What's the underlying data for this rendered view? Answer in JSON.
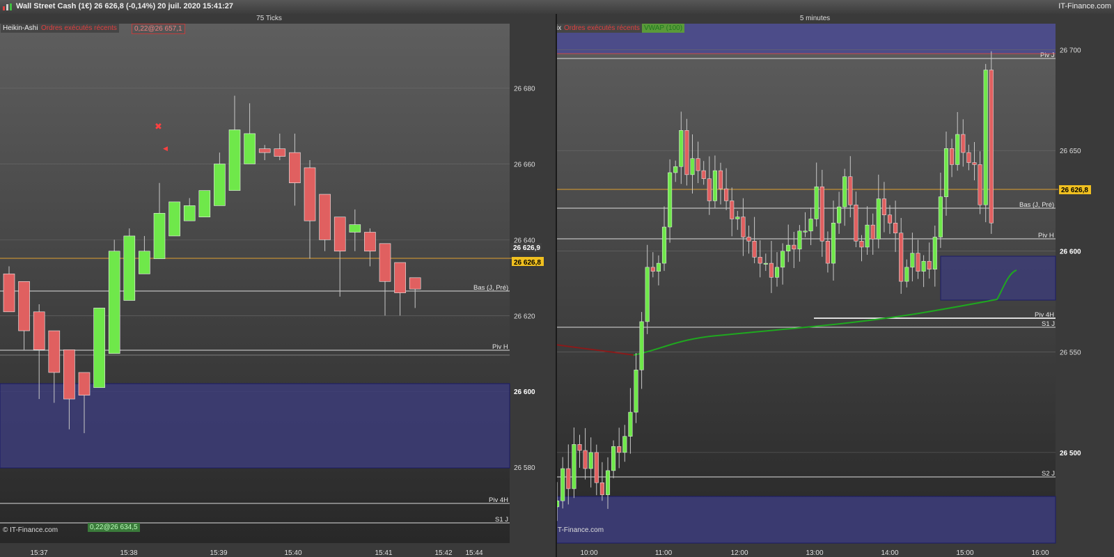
{
  "window": {
    "title": "Wall Street Cash (1€)   26 626,8 (-0,14%)   20 juil. 2020 15:41:27",
    "brand": "IT-Finance.com"
  },
  "colors": {
    "up": "#6fe84a",
    "down": "#e06060",
    "price_line": "#e0a030",
    "zone": "#3c3c78",
    "vwap": "#1fa81f",
    "ma": "#8a1a1a"
  },
  "left_chart": {
    "header": "75 Ticks",
    "tags": [
      "Heikin-Ashi",
      "Ordres exécutés récents",
      "0,22@26 657,1"
    ],
    "bottom_tag": "0,22@26 634,5",
    "watermark": "© IT-Finance.com",
    "y_ticks": [
      "26 680",
      "26 660",
      "26 640",
      "26 620",
      "26 600",
      "26 580"
    ],
    "price_labels": [
      "26 626,9",
      "26 626,8"
    ],
    "x_ticks": [
      "15:37",
      "15:38",
      "15:39",
      "15:40",
      "15:41",
      "15:42",
      "15:44"
    ],
    "levels": [
      "Bas (J, Pré)",
      "Piv H",
      "Piv 4H",
      "S1 J"
    ],
    "chart_data": {
      "type": "candlestick",
      "style": "heikin-ashi",
      "ylim": [
        26560,
        26697
      ],
      "candles": [
        {
          "o": 26631,
          "h": 26633,
          "l": 26621,
          "c": 26621,
          "dir": "down"
        },
        {
          "o": 26629,
          "h": 26629,
          "l": 26611,
          "c": 26616,
          "dir": "down"
        },
        {
          "o": 26621,
          "h": 26623,
          "l": 26598,
          "c": 26611,
          "dir": "down"
        },
        {
          "o": 26616,
          "h": 26616,
          "l": 26597,
          "c": 26605,
          "dir": "down"
        },
        {
          "o": 26611,
          "h": 26611,
          "l": 26590,
          "c": 26598,
          "dir": "down"
        },
        {
          "o": 26605,
          "h": 26605,
          "l": 26589,
          "c": 26599,
          "dir": "down"
        },
        {
          "o": 26601,
          "h": 26622,
          "l": 26601,
          "c": 26622,
          "dir": "up"
        },
        {
          "o": 26610,
          "h": 26640,
          "l": 26610,
          "c": 26637,
          "dir": "up"
        },
        {
          "o": 26624,
          "h": 26643,
          "l": 26624,
          "c": 26641,
          "dir": "up"
        },
        {
          "o": 26631,
          "h": 26641,
          "l": 26631,
          "c": 26637,
          "dir": "up"
        },
        {
          "o": 26635,
          "h": 26655,
          "l": 26635,
          "c": 26647,
          "dir": "up"
        },
        {
          "o": 26641,
          "h": 26650,
          "l": 26641,
          "c": 26650,
          "dir": "up"
        },
        {
          "o": 26645,
          "h": 26651,
          "l": 26645,
          "c": 26649,
          "dir": "up"
        },
        {
          "o": 26646,
          "h": 26653,
          "l": 26646,
          "c": 26653,
          "dir": "up"
        },
        {
          "o": 26649,
          "h": 26663,
          "l": 26649,
          "c": 26660,
          "dir": "up"
        },
        {
          "o": 26653,
          "h": 26678,
          "l": 26653,
          "c": 26669,
          "dir": "up"
        },
        {
          "o": 26660,
          "h": 26676,
          "l": 26660,
          "c": 26668,
          "dir": "up"
        },
        {
          "o": 26664,
          "h": 26665,
          "l": 26661,
          "c": 26663,
          "dir": "down"
        },
        {
          "o": 26664,
          "h": 26668,
          "l": 26661,
          "c": 26662,
          "dir": "down"
        },
        {
          "o": 26663,
          "h": 26668,
          "l": 26649,
          "c": 26655,
          "dir": "down"
        },
        {
          "o": 26659,
          "h": 26661,
          "l": 26635,
          "c": 26645,
          "dir": "down"
        },
        {
          "o": 26652,
          "h": 26652,
          "l": 26637,
          "c": 26640,
          "dir": "down"
        },
        {
          "o": 26646,
          "h": 26646,
          "l": 26625,
          "c": 26637,
          "dir": "down"
        },
        {
          "o": 26644,
          "h": 26648,
          "l": 26637,
          "c": 26642,
          "dir": "up"
        },
        {
          "o": 26642,
          "h": 26643,
          "l": 26633,
          "c": 26637,
          "dir": "down"
        },
        {
          "o": 26639,
          "h": 26639,
          "l": 26620,
          "c": 26629,
          "dir": "down"
        },
        {
          "o": 26634,
          "h": 26634,
          "l": 26620,
          "c": 26626,
          "dir": "down"
        },
        {
          "o": 26630,
          "h": 26630,
          "l": 26622,
          "c": 26627,
          "dir": "down"
        }
      ]
    }
  },
  "right_chart": {
    "header": "5 minutes",
    "tags": [
      "Prix",
      "Ordres exécutés récents",
      "VWAP (100)"
    ],
    "watermark": "© IT-Finance.com",
    "y_ticks": [
      "26 700",
      "26 650",
      "26 600",
      "26 550",
      "26 500"
    ],
    "price_label": "26 626,8",
    "x_ticks": [
      "10:00",
      "11:00",
      "12:00",
      "13:00",
      "14:00",
      "15:00",
      "16:00"
    ],
    "levels": [
      "Piv J",
      "Bas (J, Pré)",
      "Piv H",
      "Piv 4H",
      "S1 J",
      "S2 J"
    ],
    "chart_data": {
      "type": "candlestick",
      "ylim": [
        26455,
        26713
      ],
      "closes": [
        26473,
        26476,
        26492,
        26482,
        26504,
        26501,
        26492,
        26500,
        26485,
        26479,
        26491,
        26503,
        26500,
        26508,
        26520,
        26541,
        26565,
        26592,
        26590,
        26594,
        26612,
        26639,
        26642,
        26660,
        26638,
        26646,
        26640,
        26636,
        26625,
        26640,
        26631,
        26625,
        26616,
        26617,
        26607,
        26605,
        26597,
        26594,
        26594,
        26587,
        26592,
        26600,
        26603,
        26601,
        26610,
        26610,
        26616,
        26632,
        26605,
        26594,
        26614,
        26622,
        26637,
        26623,
        26605,
        26602,
        26613,
        26606,
        26626,
        26618,
        26614,
        26609,
        26585,
        26592,
        26599,
        26590,
        26595,
        26591,
        26607,
        26627,
        26651,
        26643,
        26658,
        26649,
        26644,
        26643,
        26623,
        26690,
        26614
      ]
    }
  }
}
